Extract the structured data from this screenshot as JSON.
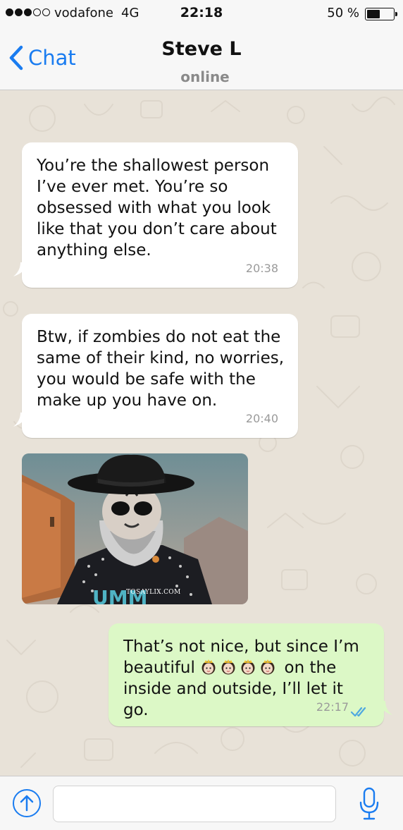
{
  "status_bar": {
    "signal_dots_filled": 3,
    "signal_dots_total": 5,
    "carrier": "vodafone",
    "network": "4G",
    "time": "22:18",
    "battery_percent_label": "50 %",
    "battery_level": 0.5
  },
  "nav": {
    "back_label": "Chat",
    "contact_name": "Steve L",
    "contact_status": "online"
  },
  "messages": [
    {
      "direction": "incoming",
      "text": "You’re the shallowest person I’ve ever met. You’re so obsessed with what you look like that you don’t care about anything else.",
      "time": "20:38"
    },
    {
      "direction": "incoming",
      "text": "Btw, if zombies do not eat the same of their kind, no worries, you would be safe with the make up you have on.",
      "time": "20:40"
    },
    {
      "direction": "incoming",
      "type": "image",
      "image_description": "bearded man with skull face paint and black hat",
      "watermark": "TOSAYLIX.COM",
      "shirt_text": "UMM"
    },
    {
      "direction": "outgoing",
      "text_before": "That’s not nice, but since I’m beautiful",
      "emoji_count": 4,
      "emoji_name": "princess-emoji",
      "text_after": "on the inside and outside, I’ll let it go.",
      "time": "22:17",
      "status_icon": "double-check-read-icon"
    }
  ],
  "input_bar": {
    "placeholder": "",
    "upload_icon": "upload-arrow-icon",
    "mic_icon": "microphone-icon"
  },
  "colors": {
    "accent": "#1a7cf0",
    "outgoing_bubble": "#dcf8c6",
    "incoming_bubble": "#ffffff",
    "chat_background": "#e8e2d8",
    "read_ticks": "#4fa8e0"
  }
}
